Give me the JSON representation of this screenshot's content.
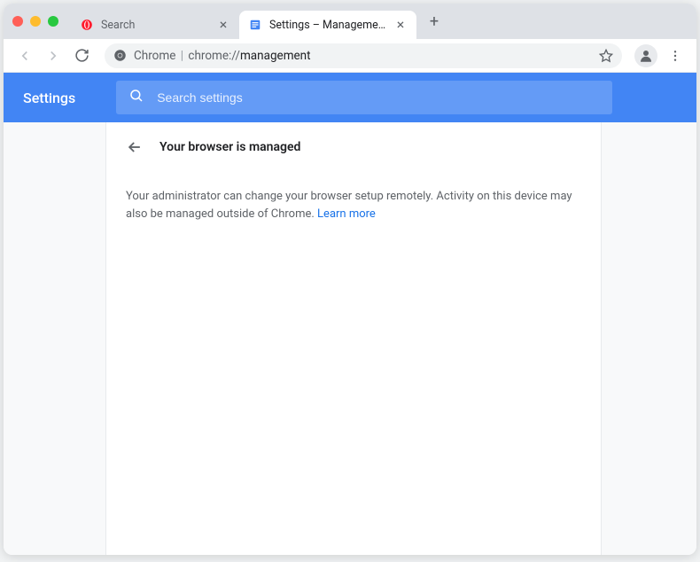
{
  "tabs": [
    {
      "title": "Search",
      "active": false,
      "favicon": "opera"
    },
    {
      "title": "Settings – Management",
      "active": true,
      "favicon": "chrome-settings"
    }
  ],
  "omnibox": {
    "prefix": "Chrome",
    "path": "chrome://",
    "bold": "management"
  },
  "settings": {
    "title": "Settings",
    "search_placeholder": "Search settings",
    "page_heading": "Your browser is managed",
    "body_text": "Your administrator can change your browser setup remotely. Activity on this device may also be managed outside of Chrome. ",
    "learn_more": "Learn more"
  }
}
